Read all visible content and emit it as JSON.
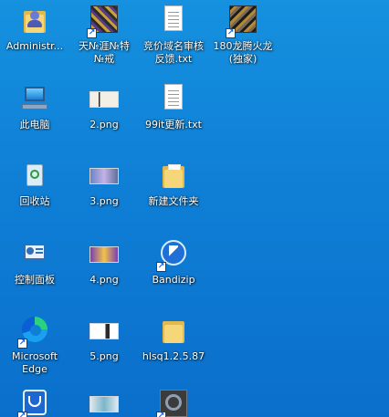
{
  "desktop": {
    "background_colors": [
      "#1591df",
      "#0a6fcb"
    ],
    "items": [
      {
        "label": "Administr...",
        "icon": "user-folder-icon"
      },
      {
        "label": "天№涯№特\n№戒",
        "icon": "mosaic-shortcut-icon"
      },
      {
        "label": "竞价域名审核\n反馈.txt",
        "icon": "text-file-icon"
      },
      {
        "label": "180龙腾火龙\n(独家)",
        "icon": "mosaic-shortcut-icon"
      },
      {
        "label": "此电脑",
        "icon": "computer-icon"
      },
      {
        "label": "2.png",
        "icon": "image-file-icon"
      },
      {
        "label": "99it更新.txt",
        "icon": "text-file-icon"
      },
      {
        "label": "回收站",
        "icon": "recycle-bin-icon"
      },
      {
        "label": "3.png",
        "icon": "image-file-icon"
      },
      {
        "label": "新建文件夹",
        "icon": "folder-icon"
      },
      {
        "label": "控制面板",
        "icon": "control-panel-icon"
      },
      {
        "label": "4.png",
        "icon": "image-file-icon"
      },
      {
        "label": "Bandizip",
        "icon": "bandizip-icon"
      },
      {
        "label": "Microsoft\nEdge",
        "icon": "edge-icon"
      },
      {
        "label": "5.png",
        "icon": "image-file-icon"
      },
      {
        "label": "hlsq1.2.5.87",
        "icon": "folder-icon"
      },
      {
        "label": "",
        "icon": "shield-app-icon"
      },
      {
        "label": "",
        "icon": "image-file-icon"
      },
      {
        "label": "",
        "icon": "tool-shortcut-icon"
      }
    ]
  }
}
